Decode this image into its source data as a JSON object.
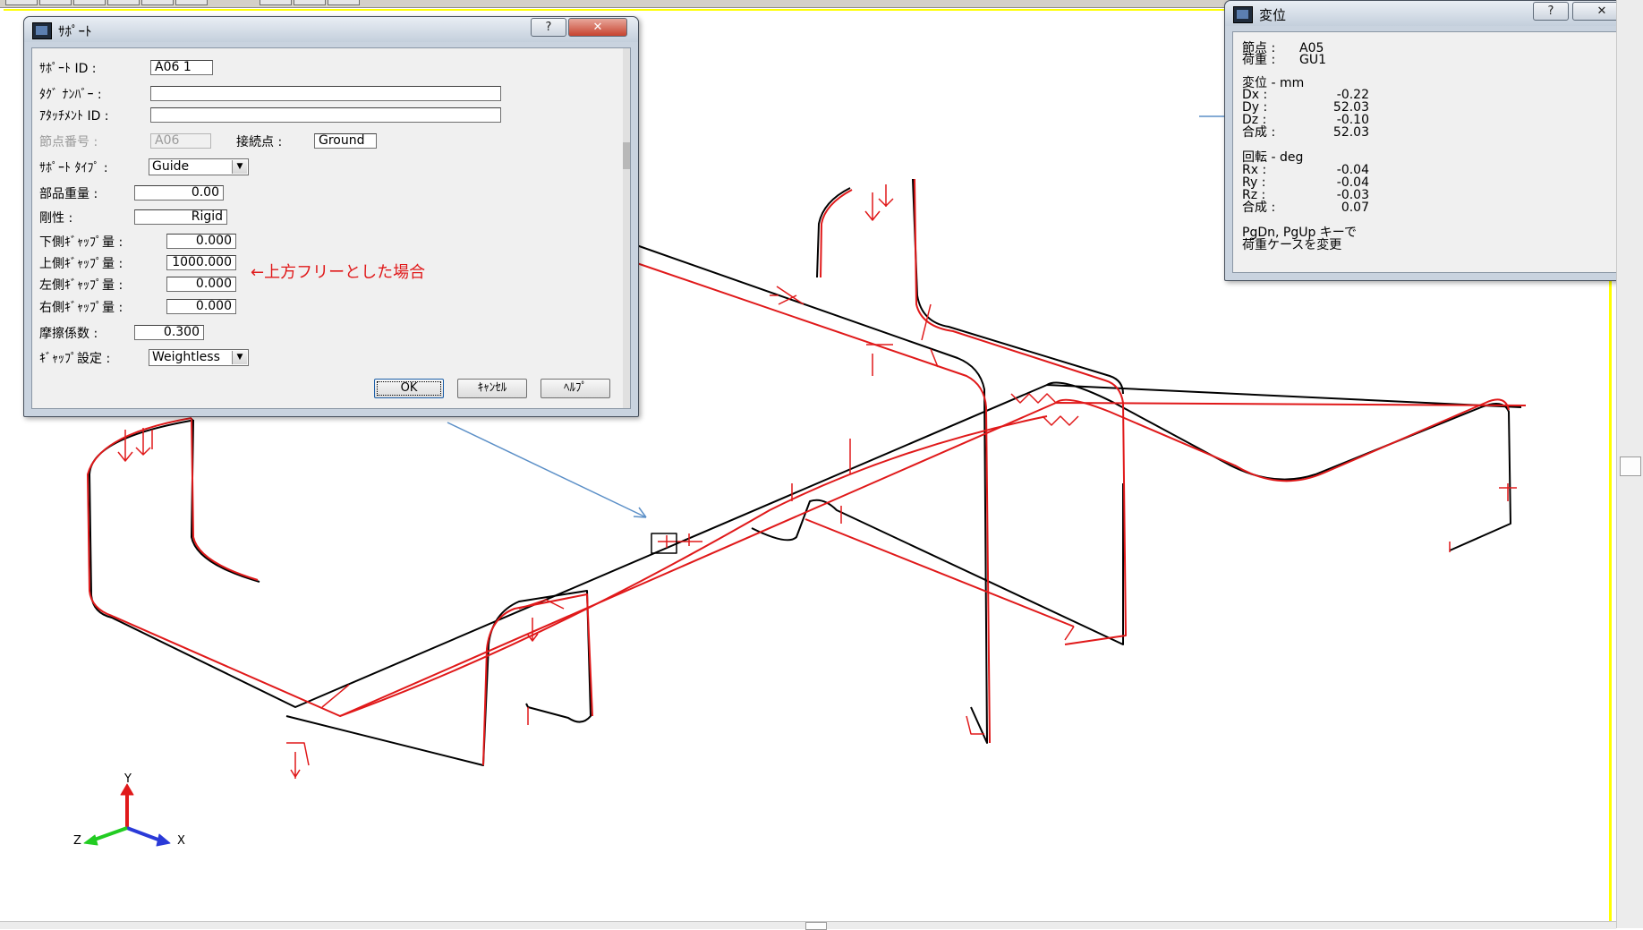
{
  "support_dialog": {
    "title": "ｻﾎﾟｰﾄ",
    "help_btn": "?",
    "close_btn": "✕",
    "fields": {
      "support_id": {
        "label": "ｻﾎﾟｰﾄ ID :",
        "value": "A06  1"
      },
      "tag_number": {
        "label": "ﾀｸﾞ ﾅﾝﾊﾞｰ :",
        "value": ""
      },
      "attachment_id": {
        "label": "ｱﾀｯﾁﾒﾝﾄ ID :",
        "value": ""
      },
      "node_number": {
        "label": "節点番号 :",
        "value": "A06"
      },
      "connection_point": {
        "label": "接続点 :",
        "value": "Ground"
      },
      "support_type": {
        "label": "ｻﾎﾟｰﾄ ﾀｲﾌﾟ :",
        "value": "Guide"
      },
      "component_weight": {
        "label": "部品重量 :",
        "value": "0.00"
      },
      "stiffness": {
        "label": "剛性 :",
        "value": "Rigid"
      },
      "lower_gap": {
        "label": "下側ｷﾞｬｯﾌﾟ量 :",
        "value": "0.000"
      },
      "upper_gap": {
        "label": "上側ｷﾞｬｯﾌﾟ量 :",
        "value": "1000.000"
      },
      "left_gap": {
        "label": "左側ｷﾞｬｯﾌﾟ量 :",
        "value": "0.000"
      },
      "right_gap": {
        "label": "右側ｷﾞｬｯﾌﾟ量 :",
        "value": "0.000"
      },
      "friction": {
        "label": "摩擦係数 :",
        "value": "0.300"
      },
      "gap_setting": {
        "label": "ｷﾞｬｯﾌﾟ設定 :",
        "value": "Weightless"
      }
    },
    "buttons": {
      "ok": "OK",
      "cancel": "ｷｬﾝｾﾙ",
      "help": "ﾍﾙﾌﾟ"
    }
  },
  "annotation": "←上方フリーとした場合",
  "displacement_window": {
    "title": "変位",
    "help_btn": "?",
    "close_btn": "✕",
    "node": {
      "label": "節点 :",
      "value": "A05"
    },
    "load": {
      "label": "荷重 :",
      "value": "GU1"
    },
    "disp_header": "変位 -   mm",
    "disp": [
      {
        "label": "Dx :",
        "value": "-0.22"
      },
      {
        "label": "Dy :",
        "value": "52.03"
      },
      {
        "label": "Dz :",
        "value": "-0.10"
      },
      {
        "label": "合成 :",
        "value": "52.03"
      }
    ],
    "rot_header": "回転 -   deg",
    "rot": [
      {
        "label": "Rx :",
        "value": "-0.04"
      },
      {
        "label": "Ry :",
        "value": "-0.04"
      },
      {
        "label": "Rz :",
        "value": "-0.03"
      },
      {
        "label": "合成 :",
        "value": "0.07"
      }
    ],
    "hint_line1": "PgDn, PgUp キーで",
    "hint_line2": "荷重ケースを変更"
  },
  "axes": {
    "y": "Y",
    "x": "X",
    "z": "Z"
  },
  "colors": {
    "deformed": "#e0191a",
    "original": "#000000",
    "viewport_border": "#ffff00",
    "pointer_arrow": "#5b8fc7",
    "y_axis": "#e0191a",
    "x_axis": "#2a3ad8",
    "z_axis": "#22cc22"
  }
}
